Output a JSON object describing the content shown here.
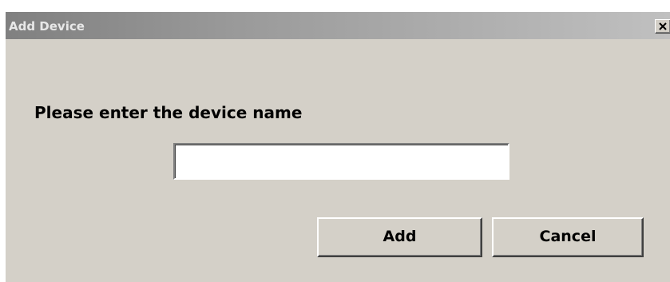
{
  "dialog": {
    "title": "Add Device",
    "close_label": "X",
    "prompt": "Please enter the device name",
    "device_name": {
      "value": "",
      "placeholder": ""
    },
    "buttons": {
      "add_label": "Add",
      "cancel_label": "Cancel"
    }
  },
  "icons": {
    "close": "close-icon"
  },
  "colors": {
    "dialog_face": "#d4d0c8",
    "titlebar_inactive_start": "#808080",
    "titlebar_inactive_end": "#c0c0c0",
    "title_text": "#e8e8e8"
  }
}
